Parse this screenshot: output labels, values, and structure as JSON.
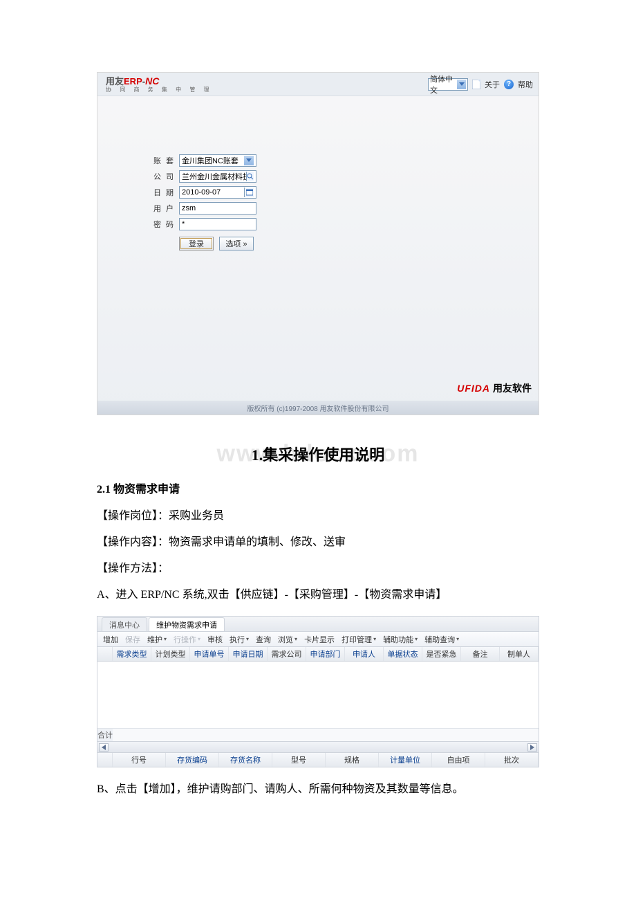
{
  "login": {
    "brand_prefix": "用友",
    "brand_erp": "ERP",
    "brand_dash": "-",
    "brand_nc": "NC",
    "brand_sub": "协 同 商 务   集 中 管 理",
    "lang_value": "简体中文",
    "about_label": "关于",
    "help_label": "帮助",
    "fields": {
      "account_label": "账 套",
      "account_value": "金川集团NC账套",
      "company_label": "公 司",
      "company_value": "兰州金川金属材料技术公司",
      "date_label": "日 期",
      "date_value": "2010-09-07",
      "user_label": "用 户",
      "user_value": "zsm",
      "password_label": "密 码",
      "password_value": "*"
    },
    "login_btn": "登录",
    "options_btn": "选项 »",
    "ufida_en": "UFIDA",
    "ufida_cn": "用友软件",
    "copyright": "版权所有  (c)1997-2008 用友软件股份有限公司"
  },
  "watermark": "www.bdocx.com",
  "section_title": "1.集采操作使用说明",
  "sub_heading": "2.1 物资需求申请",
  "para_role": "【操作岗位】：采购业务员",
  "para_content": "【操作内容】：物资需求申请单的填制、修改、送审",
  "para_method": "【操作方法】：",
  "para_a": "A、进入 ERP/NC 系统,双击【供应链】-【采购管理】-【物资需求申请】",
  "grid": {
    "tabs": {
      "msg": "消息中心",
      "active": "维护物资需求申请"
    },
    "toolbar": {
      "add": "增加",
      "save": "保存",
      "maintain": "维护",
      "rowop": "行操作",
      "review": "审核",
      "exec": "执行",
      "query": "查询",
      "browse": "浏览",
      "cardview": "卡片显示",
      "print": "打印管理",
      "assist": "辅助功能",
      "auxquery": "辅助查询"
    },
    "upper_headers": [
      "需求类型",
      "计划类型",
      "申请单号",
      "申请日期",
      "需求公司",
      "申请部门",
      "申请人",
      "单据状态",
      "是否紧急",
      "备注",
      "制单人"
    ],
    "sum_label": "合计",
    "lower_headers": [
      "行号",
      "存货编码",
      "存货名称",
      "型号",
      "规格",
      "计量单位",
      "自由项",
      "批次"
    ]
  },
  "para_b": "B、点击【增加】，维护请购部门、请购人、所需何种物资及其数量等信息。"
}
